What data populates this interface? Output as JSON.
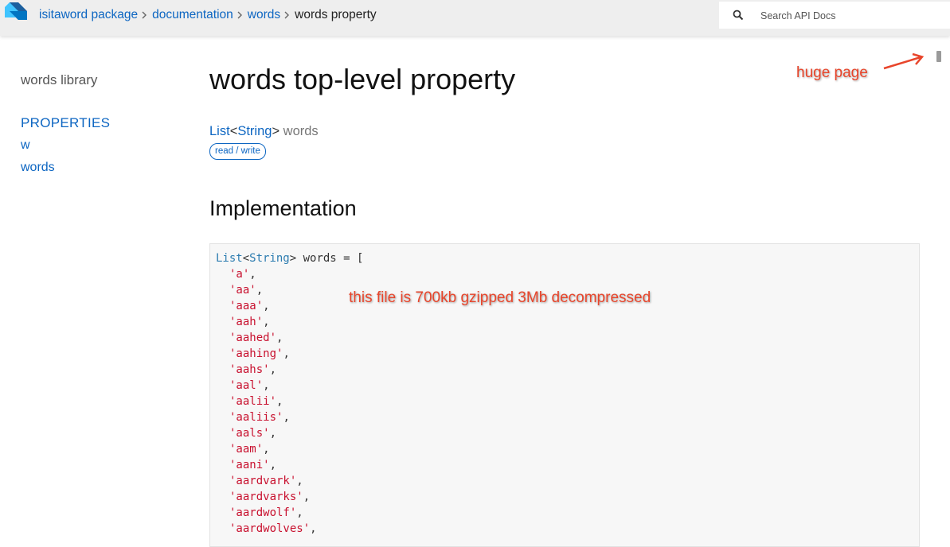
{
  "header": {
    "breadcrumbs": [
      {
        "label": "isitaword package"
      },
      {
        "label": "documentation"
      },
      {
        "label": "words"
      }
    ],
    "current": "words property",
    "search_placeholder": "Search API Docs",
    "logo_icon": "dart-logo-icon",
    "search_icon": "magnifier-icon"
  },
  "sidebar": {
    "library": "words library",
    "section": "PROPERTIES",
    "items": [
      {
        "label": "w"
      },
      {
        "label": "words"
      }
    ]
  },
  "main": {
    "title": "words top-level property",
    "signature": {
      "type": "List",
      "open": "<",
      "type_param": "String",
      "close": ">",
      "name": "words"
    },
    "badge": "read / write",
    "impl_heading": "Implementation",
    "code": {
      "decl_type": "List",
      "decl_open": "<",
      "decl_param": "String",
      "decl_rest": "> words = [",
      "entries": [
        "'a'",
        "'aa'",
        "'aaa'",
        "'aah'",
        "'aahed'",
        "'aahing'",
        "'aahs'",
        "'aal'",
        "'aalii'",
        "'aaliis'",
        "'aals'",
        "'aam'",
        "'aani'",
        "'aardvark'",
        "'aardvarks'",
        "'aardwolf'",
        "'aardwolves'"
      ]
    }
  },
  "annotations": {
    "huge_page": "huge page",
    "file_size": "this file is 700kb gzipped 3Mb decompressed",
    "color": "#e8452b"
  },
  "colors": {
    "link": "#0d66c2",
    "string": "#c8102e",
    "type": "#2c7cb0",
    "header_bg": "#eeeeee"
  }
}
